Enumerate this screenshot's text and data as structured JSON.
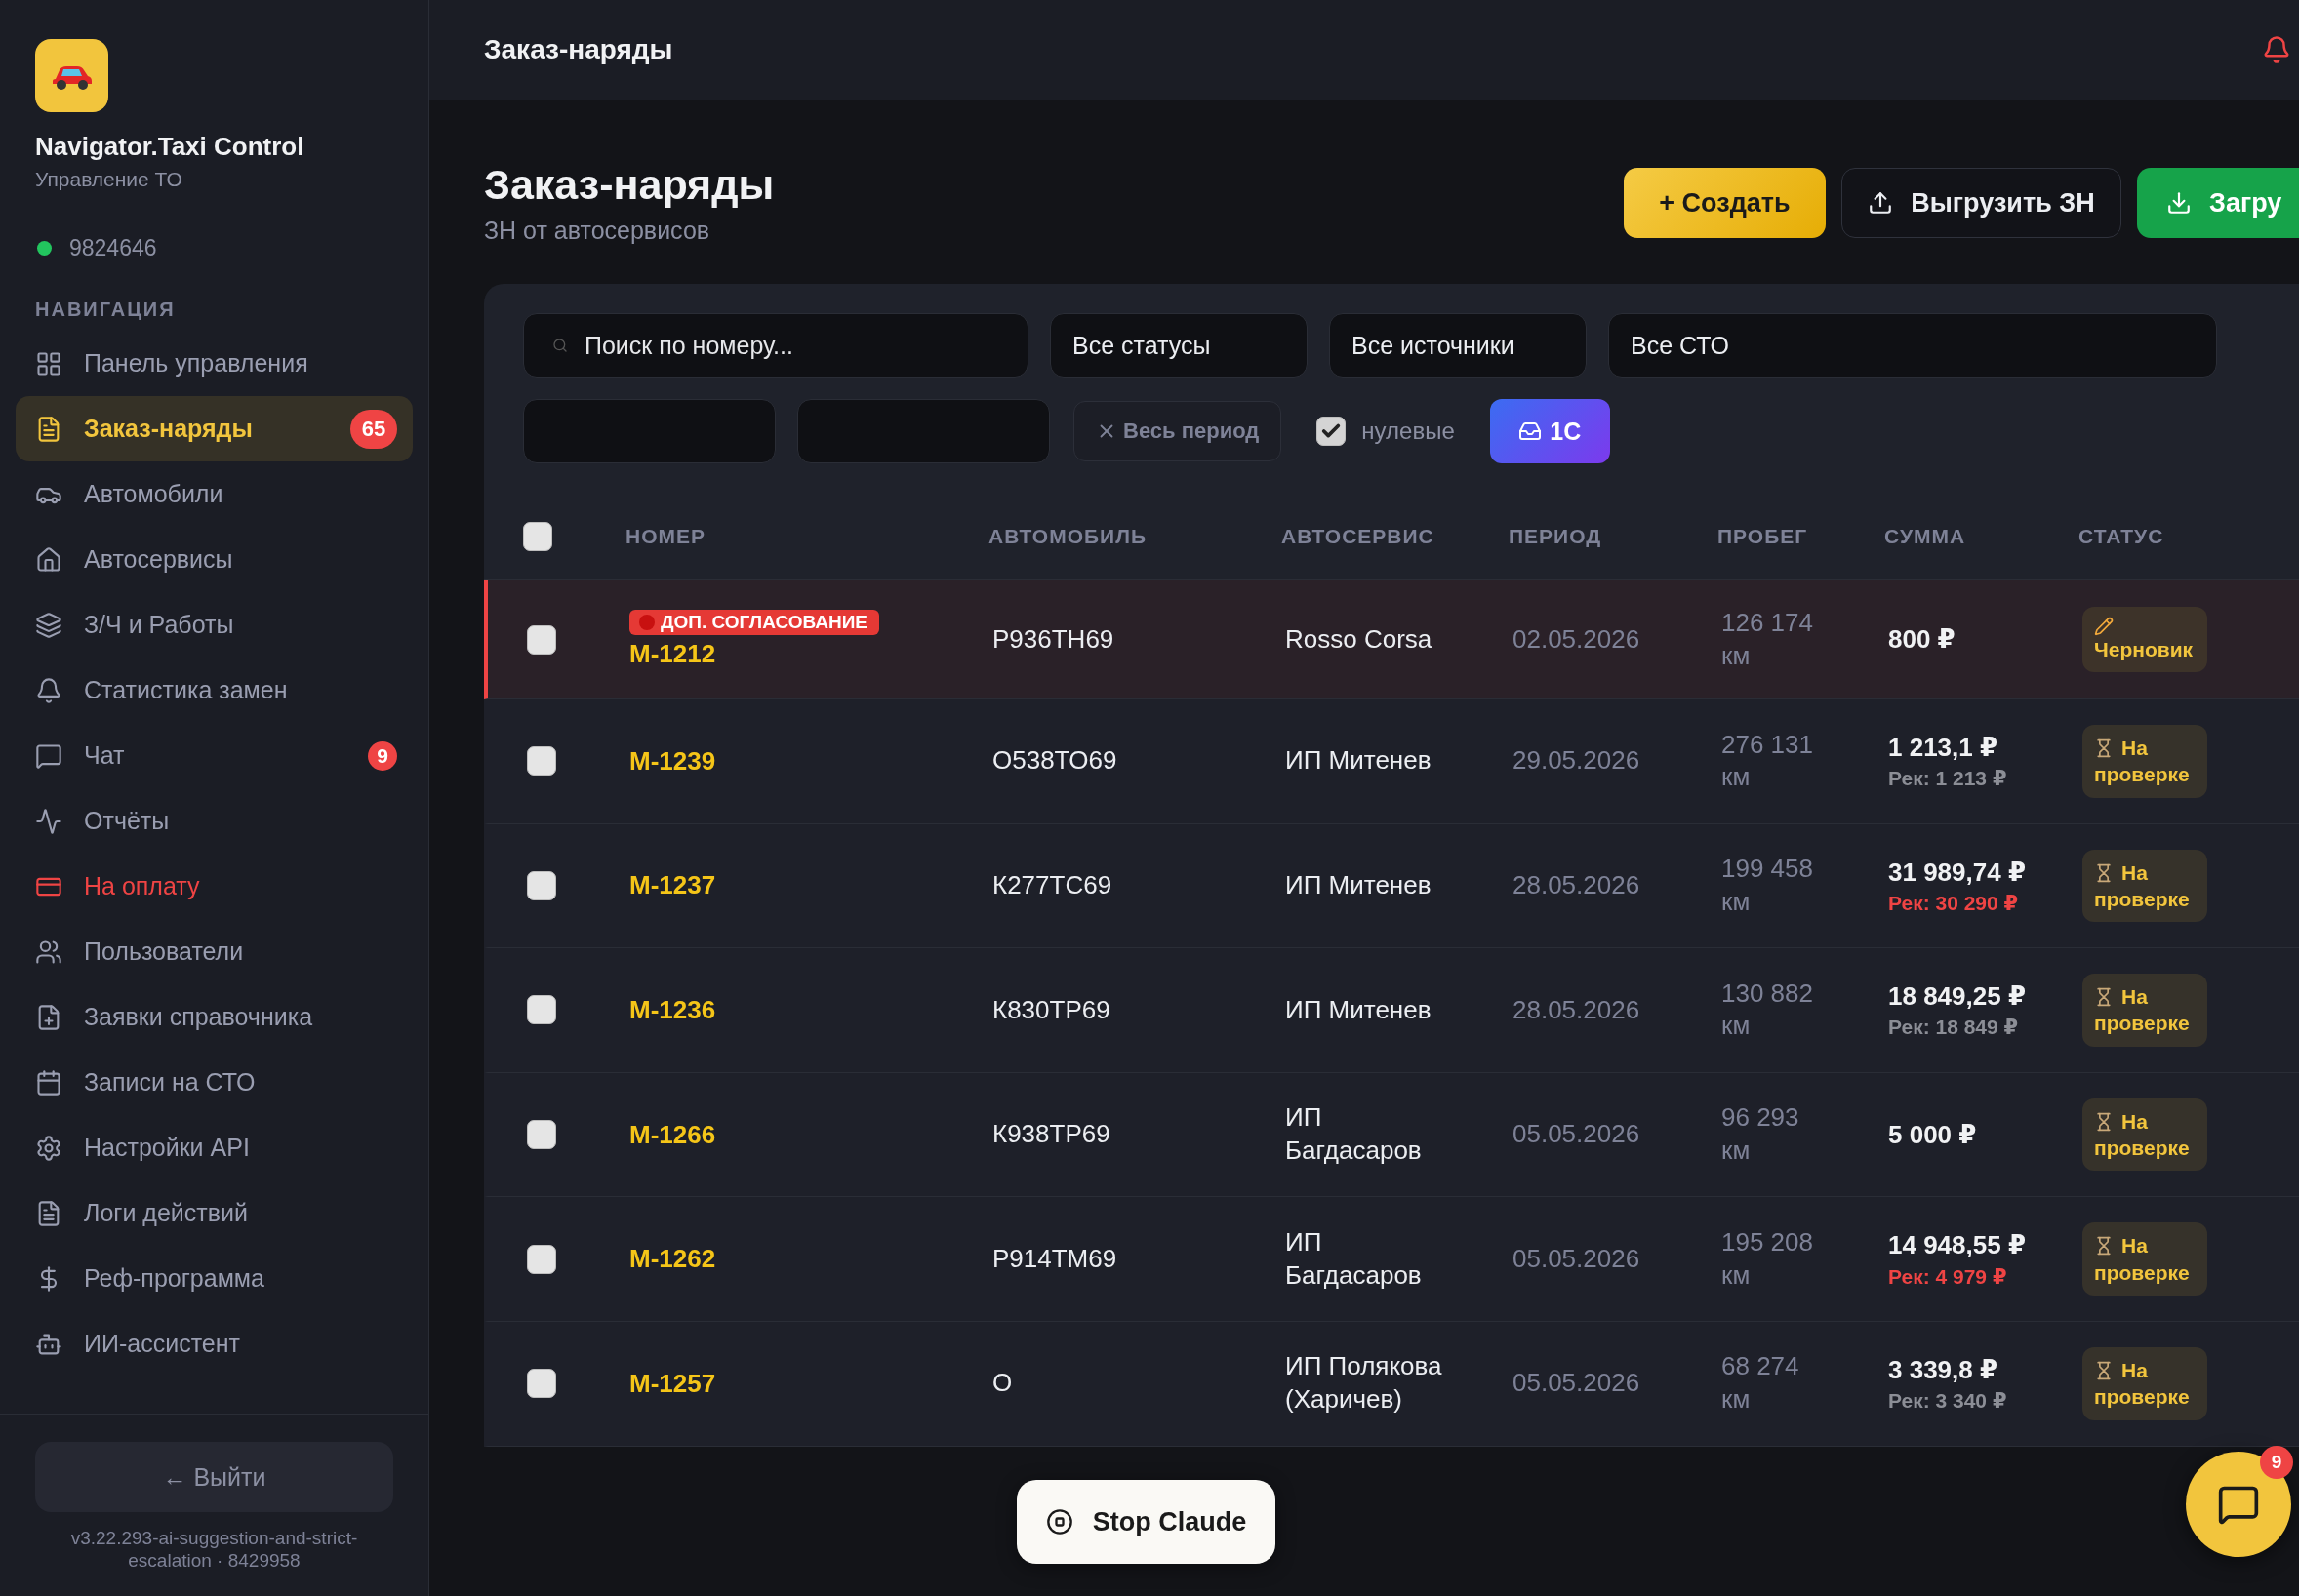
{
  "sidebar": {
    "app_name": "Navigator.Taxi Control",
    "app_subtitle": "Управление ТО",
    "status": {
      "online": true,
      "text": "9824646"
    },
    "section_title": "НАВИГАЦИЯ",
    "items": [
      {
        "label": "Панель управления",
        "selected": false,
        "alert": false
      },
      {
        "label": "Заказ-наряды",
        "selected": true,
        "alert": false,
        "badge": "65"
      },
      {
        "label": "Автомобили",
        "selected": false,
        "alert": false
      },
      {
        "label": "Автосервисы",
        "selected": false,
        "alert": false
      },
      {
        "label": "З/Ч и Работы",
        "selected": false,
        "alert": false
      },
      {
        "label": "Статистика замен",
        "selected": false,
        "alert": false
      },
      {
        "label": "Чат",
        "selected": false,
        "alert": false,
        "badge": "9"
      },
      {
        "label": "Отчёты",
        "selected": false,
        "alert": false
      },
      {
        "label": "На оплату",
        "selected": false,
        "alert": true
      },
      {
        "label": "Пользователи",
        "selected": false,
        "alert": false
      },
      {
        "label": "Заявки справочника",
        "selected": false,
        "alert": false
      },
      {
        "label": "Записи на СТО",
        "selected": false,
        "alert": false
      },
      {
        "label": "Настройки API",
        "selected": false,
        "alert": false
      },
      {
        "label": "Логи действий",
        "selected": false,
        "alert": false
      },
      {
        "label": "Реф-программа",
        "selected": false,
        "alert": false
      },
      {
        "label": "ИИ-ассистент",
        "selected": false,
        "alert": false
      }
    ],
    "logout": "← Выйти",
    "version": "v3.22.293-ai-suggestion-and-strict-escalation · 8429958"
  },
  "topbar": {
    "title": "Заказ-наряды"
  },
  "page": {
    "title": "Заказ-наряды",
    "subtitle": "ЗН от автосервисов",
    "actions": [
      {
        "kind": "create",
        "label": "+ Создать"
      },
      {
        "kind": "export",
        "label": "Выгрузить ЗН"
      },
      {
        "kind": "import",
        "label": "Загру"
      }
    ]
  },
  "filters": {
    "search": {
      "placeholder": "Поиск по номеру..."
    },
    "selects": [
      "Все статусы",
      "Все источники",
      "Все СТО"
    ],
    "period_button": "Весь период",
    "zero_toggle": {
      "label": "нулевые",
      "checked": true
    },
    "source_button": "1С"
  },
  "table": {
    "all_checked": false,
    "columns": [
      "НОМЕР",
      "АВТОМОБИЛЬ",
      "АВТОСЕРВИС",
      "ПЕРИОД",
      "ПРОБЕГ",
      "СУММА",
      "СТАТУС"
    ],
    "rows": [
      {
        "checked": false,
        "flag": "ДОП. СОГЛАСОВАНИЕ",
        "number": "М-1212",
        "car": "Р936ТН69",
        "service": "Rosso Corsa",
        "period": "02.05.2026",
        "mileage": "126 174 км",
        "sum": "800 ₽",
        "status": {
          "kind": "draft",
          "label": "Черновик"
        }
      },
      {
        "checked": false,
        "number": "М-1239",
        "car": "О538ТО69",
        "service": "ИП Митенев",
        "period": "29.05.2026",
        "mileage": "276 131 км",
        "sum": "1 213,1 ₽",
        "rec": {
          "text": "Рек: 1 213 ₽",
          "alert": false
        },
        "status": {
          "kind": "review",
          "label": "На проверке"
        }
      },
      {
        "checked": false,
        "number": "М-1237",
        "car": "К277ТС69",
        "service": "ИП Митенев",
        "period": "28.05.2026",
        "mileage": "199 458 км",
        "sum": "31 989,74 ₽",
        "rec": {
          "text": "Рек: 30 290 ₽",
          "alert": true
        },
        "status": {
          "kind": "review",
          "label": "На проверке"
        }
      },
      {
        "checked": false,
        "number": "М-1236",
        "car": "К830ТР69",
        "service": "ИП Митенев",
        "period": "28.05.2026",
        "mileage": "130 882 км",
        "sum": "18 849,25 ₽",
        "rec": {
          "text": "Рек: 18 849 ₽",
          "alert": false
        },
        "status": {
          "kind": "review",
          "label": "На проверке"
        }
      },
      {
        "checked": false,
        "number": "М-1266",
        "car": "К938ТР69",
        "service": "ИП Багдасаров",
        "period": "05.05.2026",
        "mileage": "96 293 км",
        "sum": "5 000 ₽",
        "status": {
          "kind": "review",
          "label": "На проверке"
        }
      },
      {
        "checked": false,
        "number": "М-1262",
        "car": "Р914ТМ69",
        "service": "ИП Багдасаров",
        "period": "05.05.2026",
        "mileage": "195 208 км",
        "sum": "14 948,55 ₽",
        "rec": {
          "text": "Рек: 4 979 ₽",
          "alert": true
        },
        "status": {
          "kind": "review",
          "label": "На проверке"
        }
      },
      {
        "checked": false,
        "number": "М-1257",
        "car": "О",
        "service": "ИП Полякова (Харичев)",
        "period": "05.05.2026",
        "mileage": "68 274 км",
        "sum": "3 339,8 ₽",
        "rec": {
          "text": "Рек: 3 340 ₽",
          "alert": false
        },
        "status": {
          "kind": "review",
          "label": "На проверке"
        }
      }
    ]
  },
  "overlay": {
    "stop_button": "Stop Claude"
  },
  "chat_fab": {
    "badge": "9"
  }
}
